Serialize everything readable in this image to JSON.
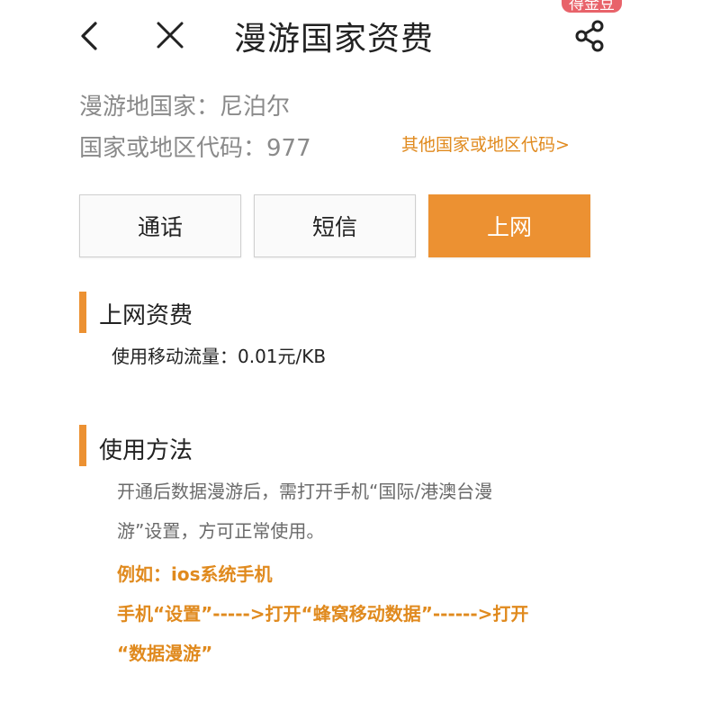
{
  "header": {
    "title": "漫游国家资费",
    "badge": "得金豆",
    "icons": [
      "back-icon",
      "close-icon",
      "share-icon"
    ]
  },
  "info": {
    "roaming_country": "漫游地国家：尼泊尔",
    "country_code": "国家或地区代码：977",
    "other_codes_link": "其他国家或地区代码>"
  },
  "tabs": [
    {
      "label": "通话",
      "active": false
    },
    {
      "label": "短信",
      "active": false
    },
    {
      "label": "上网",
      "active": true
    }
  ],
  "data_rate": {
    "title": "上网资费",
    "text": "使用移动流量：0.01元/KB"
  },
  "usage": {
    "title": "使用方法",
    "desc_line1": "开通后数据漫游后，需打开手机“国际/港澳台漫",
    "desc_line2": "游”设置，方可正常使用。",
    "example_line1": "例如：ios系统手机",
    "example_line2": "手机“设置”----->打开“蜂窝移动数据”------>打开",
    "example_line3": "“数据漫游”"
  },
  "colors": {
    "accent": "#ec9132",
    "link": "#e08a1e",
    "badge": "#e8636a"
  }
}
